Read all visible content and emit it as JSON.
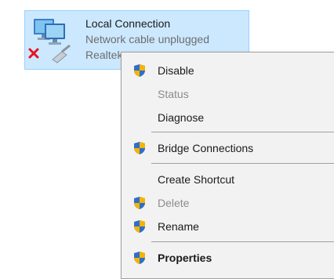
{
  "connection": {
    "name": "Local Connection",
    "status": "Network cable unplugged",
    "adapter": "Realtek"
  },
  "context_menu": {
    "items": [
      {
        "label": "Disable",
        "shield": true,
        "disabled": false,
        "bold": false
      },
      {
        "label": "Status",
        "shield": false,
        "disabled": true,
        "bold": false
      },
      {
        "label": "Diagnose",
        "shield": false,
        "disabled": false,
        "bold": false
      },
      {
        "label": "Bridge Connections",
        "shield": true,
        "disabled": false,
        "bold": false
      },
      {
        "label": "Create Shortcut",
        "shield": false,
        "disabled": false,
        "bold": false
      },
      {
        "label": "Delete",
        "shield": true,
        "disabled": true,
        "bold": false
      },
      {
        "label": "Rename",
        "shield": true,
        "disabled": false,
        "bold": false
      },
      {
        "label": "Properties",
        "shield": true,
        "disabled": false,
        "bold": true
      }
    ]
  },
  "colors": {
    "selection_bg": "#cce8ff",
    "menu_bg": "#f2f2f2",
    "disabled_text": "#8c8c8c",
    "shield_blue": "#2f6ecb",
    "shield_gold": "#f2b400",
    "error_red": "#e81123"
  }
}
